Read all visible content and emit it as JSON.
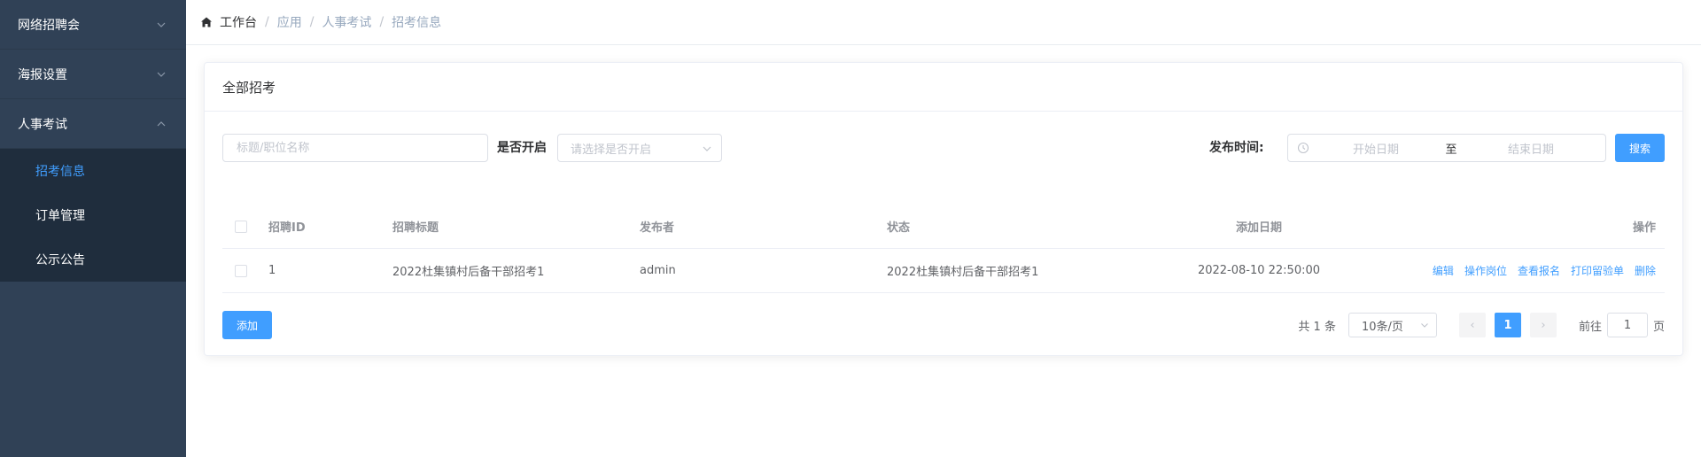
{
  "sidebar": {
    "groups": [
      {
        "label": "网络招聘会"
      },
      {
        "label": "海报设置"
      },
      {
        "label": "人事考试"
      }
    ],
    "submenu": [
      {
        "label": "招考信息"
      },
      {
        "label": "订单管理"
      },
      {
        "label": "公示公告"
      }
    ]
  },
  "breadcrumb": {
    "items": [
      "工作台",
      "应用",
      "人事考试",
      "招考信息"
    ],
    "separator": "/"
  },
  "card": {
    "title": "全部招考"
  },
  "filters": {
    "keyword_placeholder": "标题/职位名称",
    "enabled_label": "是否开启",
    "enabled_placeholder": "请选择是否开启",
    "publish_label": "发布时间:",
    "start_placeholder": "开始日期",
    "range_sep": "至",
    "end_placeholder": "结束日期",
    "search_button": "搜索"
  },
  "table": {
    "headers": {
      "id": "招聘ID",
      "title": "招聘标题",
      "publisher": "发布者",
      "status": "状态",
      "date": "添加日期",
      "ops": "操作"
    },
    "rows": [
      {
        "id": "1",
        "title": "2022杜集镇村后备干部招考1",
        "publisher": "admin",
        "status": "2022杜集镇村后备干部招考1",
        "date": "2022-08-10 22:50:00",
        "ops": [
          "编辑",
          "操作岗位",
          "查看报名",
          "打印留验单",
          "删除"
        ]
      }
    ]
  },
  "footer": {
    "add_button": "添加",
    "total": "共 1 条",
    "page_size": "10条/页",
    "prev": "‹",
    "current_page": "1",
    "next": "›",
    "goto_label": "前往",
    "goto_value": "1",
    "goto_suffix": "页"
  },
  "colors": {
    "sidebar_bg": "#304156",
    "submenu_bg": "#1f2d3d",
    "primary": "#409eff"
  }
}
